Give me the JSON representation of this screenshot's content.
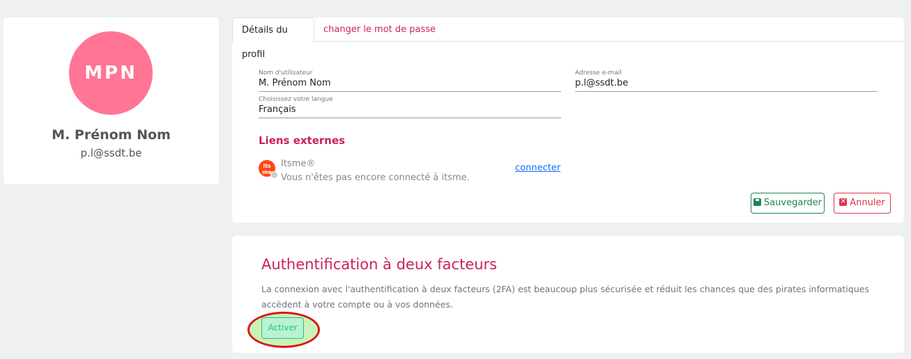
{
  "profile": {
    "initials": "MPN",
    "name": "M. Prénom Nom",
    "email": "p.l@ssdt.be",
    "avatar_color": "#ff7593"
  },
  "tabs": {
    "details": "Détails du profil",
    "password": "changer le mot de passe"
  },
  "form": {
    "username": {
      "label": "Nom d'utilisateur",
      "value": "M. Prénom Nom"
    },
    "email": {
      "label": "Adresse e-mail",
      "value": "p.l@ssdt.be"
    },
    "language": {
      "label": "Choisissez votre langue",
      "value": "Français"
    }
  },
  "external_links": {
    "title": "Liens externes",
    "itsme": {
      "logo_text": "its me",
      "name": "Itsme®",
      "description": "Vous n'êtes pas encore connecté à itsme.",
      "connect_label": "connecter"
    }
  },
  "actions": {
    "save_label": "Sauvegarder",
    "cancel_label": "Annuler",
    "save_icon": "floppy-disk-icon",
    "cancel_icon": "close-square-icon"
  },
  "two_factor": {
    "title": "Authentification à deux facteurs",
    "description": "La connexion avec l'authentification à deux facteurs (2FA) est beaucoup plus sécurisée et réduit les chances que des pirates informatiques accèdent à votre compte ou à vos données.",
    "activate_label": "Activer"
  },
  "colors": {
    "accent": "#cc1f5f",
    "success": "#198754",
    "danger": "#dc3545",
    "link": "#0d6efd"
  }
}
